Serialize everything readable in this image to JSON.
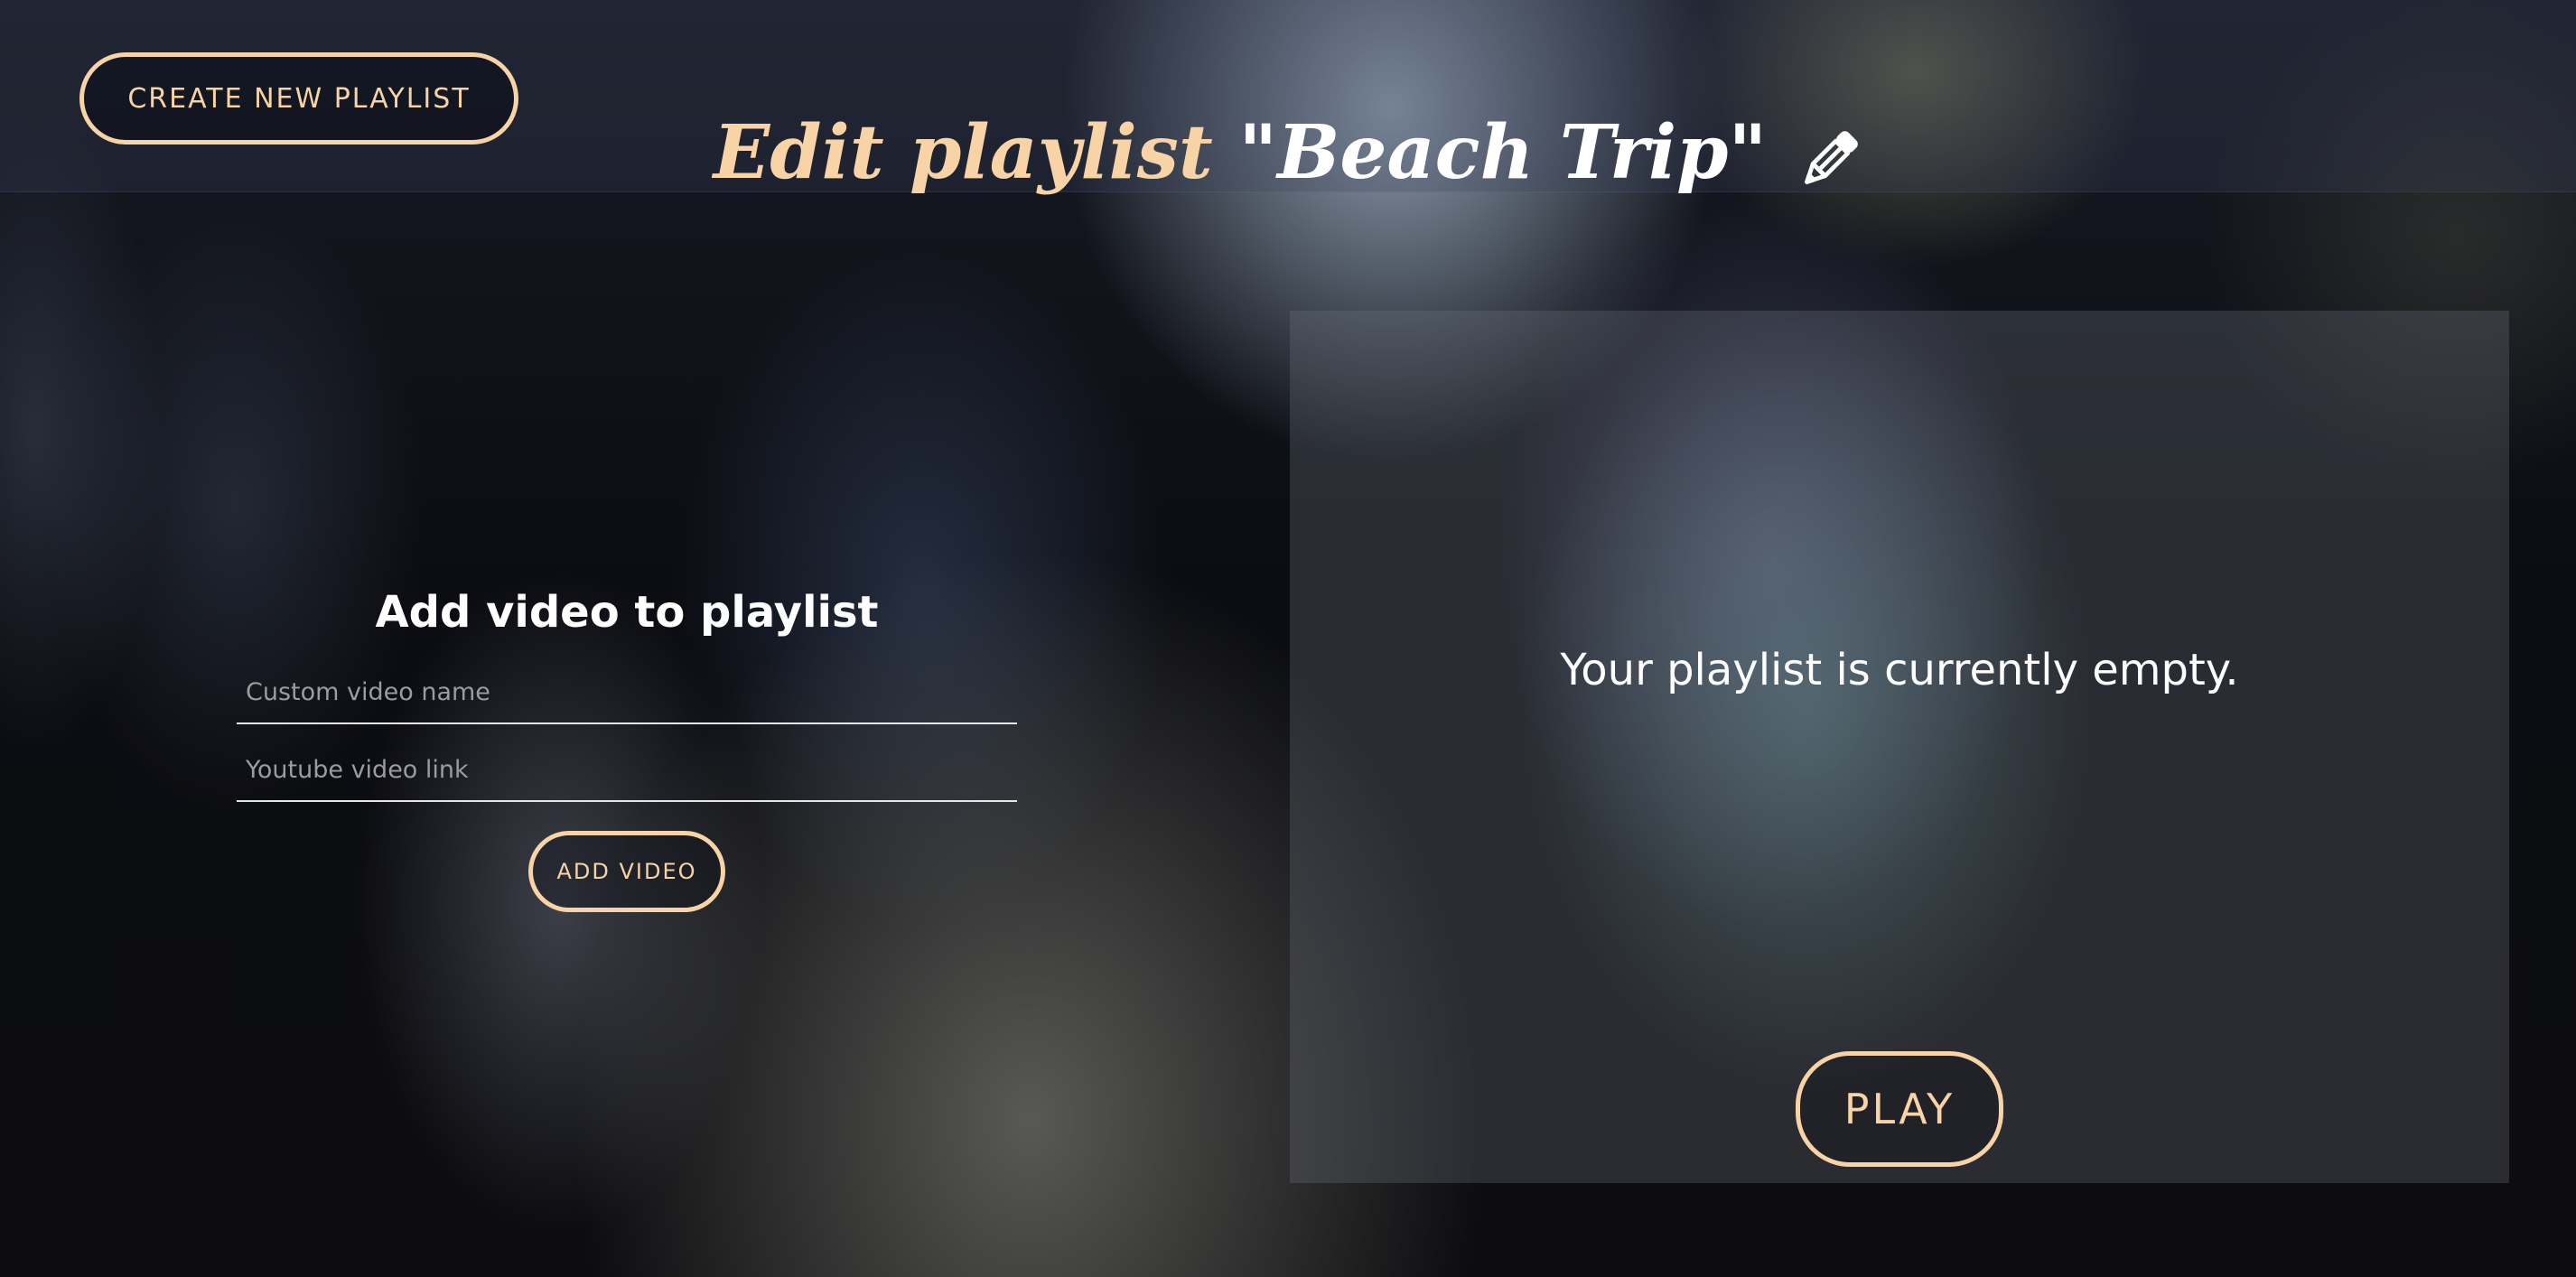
{
  "header": {
    "create_button_label": "CREATE NEW PLAYLIST",
    "title_prefix": "Edit playlist ",
    "playlist_name": "\"Beach Trip\"",
    "edit_icon": "pencil-icon"
  },
  "add_video": {
    "title": "Add video to playlist",
    "name_placeholder": "Custom video name",
    "name_value": "",
    "link_placeholder": "Youtube video link",
    "link_value": "",
    "button_label": "ADD VIDEO"
  },
  "playlist_panel": {
    "empty_message": "Your playlist is currently empty.",
    "play_button_label": "PLAY"
  },
  "colors": {
    "accent": "#f7d3a6",
    "text": "#ffffff"
  }
}
